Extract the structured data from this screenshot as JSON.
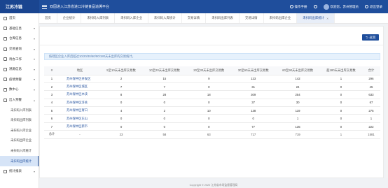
{
  "app": {
    "brand": "江苏冷链",
    "system_title": "双因进入江苏省进口冷链食品追溯平台"
  },
  "header": {
    "manual": "操作手册",
    "welcome": "欢迎您，苏州管理员",
    "logout": "退出登录"
  },
  "sidebar": {
    "items": [
      {
        "label": "首页",
        "chevron": ""
      },
      {
        "label": "基础信息",
        "chevron": "▾"
      },
      {
        "label": "仓库信息",
        "chevron": "▾"
      },
      {
        "label": "交易查询",
        "chevron": "▾"
      },
      {
        "label": "待办工作",
        "chevron": "▾"
      },
      {
        "label": "溯源信息",
        "chevron": "▾"
      },
      {
        "label": "疫情预警",
        "chevron": "▾"
      },
      {
        "label": "数中心",
        "chevron": "▾"
      },
      {
        "label": "出入预警",
        "chevron": "▴"
      }
    ],
    "sub_items": [
      {
        "label": "未扫码入库列表"
      },
      {
        "label": "未扫码出库列表"
      },
      {
        "label": "未扫码入库企业"
      },
      {
        "label": "未扫码出库企业"
      },
      {
        "label": "未扫码入库统计"
      },
      {
        "label": "未扫码出库统计"
      }
    ],
    "bottom": {
      "label": "统计报表",
      "chevron": "▾"
    }
  },
  "tabs": [
    {
      "label": "首页"
    },
    {
      "label": "企业统计"
    },
    {
      "label": "未扫码入库列表"
    },
    {
      "label": "未扫码入库企业"
    },
    {
      "label": "未扫码入库统计"
    },
    {
      "label": "交易详情"
    },
    {
      "label": "未扫码出库列表"
    },
    {
      "label": "交易详情"
    },
    {
      "label": "未扫码出库企业"
    },
    {
      "label": "未扫码出库统计"
    }
  ],
  "page": {
    "back_label": "返回",
    "note": "按辖区企业入库后超过10/20/30/60/90/180天未出库的交易统计。"
  },
  "table": {
    "headers": [
      "#",
      "地区",
      "5至10天未出库交易数",
      "10至20天未出库交易数",
      "20至30天未出库交易数",
      "30至60天未出库交易数",
      "60至90天未出库交易数",
      "超180天未出库交易数",
      "合计"
    ],
    "rows": [
      [
        "1",
        "苏州保中区开发区",
        "2",
        "15",
        "9",
        "123",
        "142",
        "1",
        "296"
      ],
      [
        "2",
        "苏州保中区城区",
        "7",
        "7",
        "0",
        "31",
        "24",
        "0",
        "45"
      ],
      [
        "3",
        "苏州保中区木渎",
        "8",
        "28",
        "18",
        "309",
        "254",
        "0",
        "633"
      ],
      [
        "4",
        "苏州保中区浒关",
        "0",
        "0",
        "0",
        "37",
        "30",
        "0",
        "67"
      ],
      [
        "5",
        "苏州保中区胥口",
        "4",
        "2",
        "10",
        "138",
        "119",
        "0",
        "275"
      ],
      [
        "6",
        "苏州保中区东山",
        "0",
        "0",
        "0",
        "0",
        "1",
        "0",
        "1"
      ],
      [
        "7",
        "苏州保中区新市",
        "0",
        "0",
        "0",
        "77",
        "135",
        "0",
        "222"
      ],
      [
        "总计",
        "-",
        "23",
        "58",
        "63",
        "717",
        "719",
        "1",
        "1581"
      ]
    ]
  },
  "footer": {
    "text": "Copyright © 2020 江苏省市场监督管理局"
  }
}
